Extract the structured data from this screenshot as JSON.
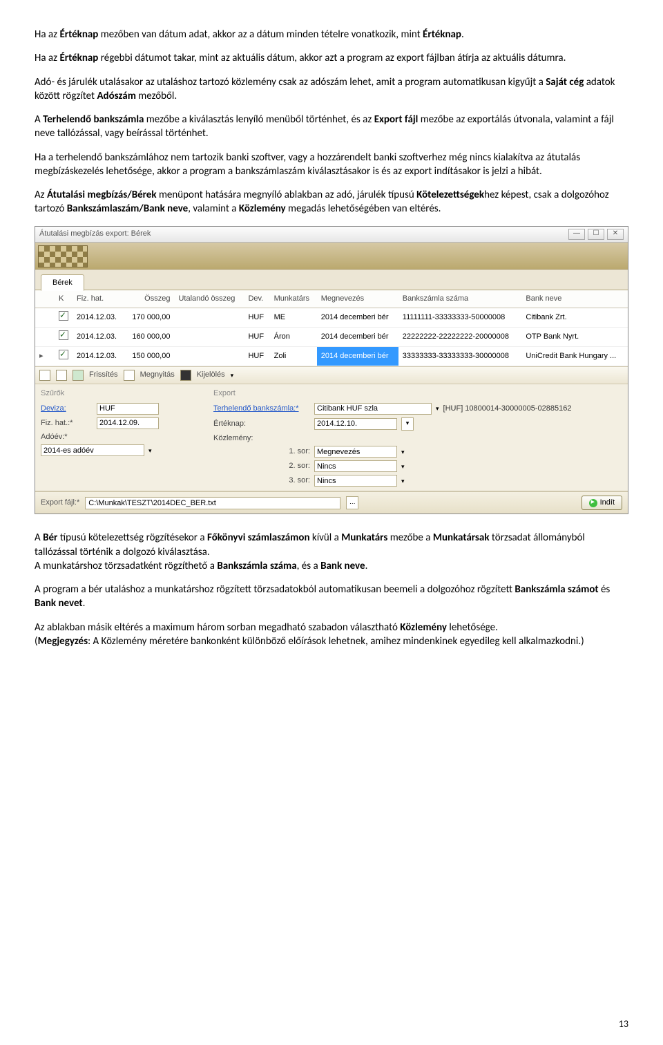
{
  "paragraphs": {
    "p1a": "Ha az ",
    "p1b": "Értéknap",
    "p1c": " mezőben van dátum adat, akkor az a dátum minden tételre vonatkozik, mint ",
    "p1d": "Értéknap",
    "p1e": ".",
    "p2a": "Ha az ",
    "p2b": "Értéknap",
    "p2c": " régebbi dátumot takar, mint az aktuális dátum, akkor azt a program az export fájlban átírja az aktuális dátumra.",
    "p3a": "Adó- és járulék utalásakor az utaláshoz tartozó közlemény csak az adószám lehet, amit a program automatikusan kigyűjt a ",
    "p3b": "Saját cég",
    "p3c": " adatok között rögzítet ",
    "p3d": "Adószám",
    "p3e": " mezőből.",
    "p4a": "A ",
    "p4b": "Terhelendő bankszámla",
    "p4c": " mezőbe a kiválasztás lenyíló menüből történhet, és az ",
    "p4d": "Export fájl",
    "p4e": " mezőbe az exportálás útvonala, valamint a fájl neve tallózással, vagy beírással történhet.",
    "p5": "Ha a terhelendő bankszámlához nem tartozik banki szoftver, vagy a hozzárendelt banki szoftverhez még nincs kialakítva az átutalás megbízáskezelés lehetősége, akkor a program a bankszámlaszám kiválasztásakor is és az export indításakor is jelzi a hibát.",
    "p6a": "Az ",
    "p6b": "Átutalási megbízás/Bérek",
    "p6c": " menüpont hatására megnyíló ablakban az adó, járulék típusú ",
    "p6d": "Kötelezettségek",
    "p6e": "hez képest, csak a dolgozóhoz tartozó ",
    "p6f": "Bankszámlaszám/Bank neve",
    "p6g": ", valamint a ",
    "p6h": "Közlemény",
    "p6i": " megadás lehetőségében van eltérés.",
    "p7a": "A ",
    "p7b": "Bér",
    "p7c": " típusú kötelezettség rögzítésekor a ",
    "p7d": "Főkönyvi számlaszámon",
    "p7e": " kívül a ",
    "p7f": "Munkatárs",
    "p7g": " mezőbe a ",
    "p7h": "Munkatársak",
    "p7i": " törzsadat állományból tallózással történik a dolgozó kiválasztása.",
    "p8a": "A munkatárshoz törzsadatként rögzíthető a ",
    "p8b": "Bankszámla száma",
    "p8c": ", és a ",
    "p8d": "Bank neve",
    "p8e": ".",
    "p9a": "A program a bér utaláshoz a munkatárshoz rögzített törzsadatokból automatikusan beemeli a dolgozóhoz rögzített ",
    "p9b": "Bankszámla számot",
    "p9c": " és ",
    "p9d": "Bank nevet",
    "p9e": ".",
    "p10a": "Az ablakban másik eltérés a maximum három sorban megadható szabadon választható ",
    "p10b": "Közlemény",
    "p10c": " lehetősége.",
    "p11a": "(",
    "p11b": "Megjegyzés",
    "p11c": ": A Közlemény méretére bankonként különböző előírások lehetnek, amihez mindenkinek egyedileg kell alkalmazkodni.)"
  },
  "window": {
    "title": "Átutalási megbízás export: Bérek",
    "tab": "Bérek",
    "headers": {
      "k": "K",
      "fizhat": "Fiz. hat.",
      "osszeg": "Összeg",
      "utalando": "Utalandó összeg",
      "dev": "Dev.",
      "munkatars": "Munkatárs",
      "megnevezes": "Megnevezés",
      "banksz": "Bankszámla száma",
      "bank": "Bank neve"
    },
    "rows": [
      {
        "fizhat": "2014.12.03.",
        "osszeg": "170 000,00",
        "utalando": "",
        "dev": "HUF",
        "munkatars": "ME",
        "megnevezes": "2014 decemberi bér",
        "banksz": "11111111-33333333-50000008",
        "bank": "Citibank Zrt."
      },
      {
        "fizhat": "2014.12.03.",
        "osszeg": "160 000,00",
        "utalando": "",
        "dev": "HUF",
        "munkatars": "Áron",
        "megnevezes": "2014 decemberi bér",
        "banksz": "22222222-22222222-20000008",
        "bank": "OTP Bank Nyrt."
      },
      {
        "fizhat": "2014.12.03.",
        "osszeg": "150 000,00",
        "utalando": "",
        "dev": "HUF",
        "munkatars": "Zoli",
        "megnevezes": "2014 decemberi bér",
        "banksz": "33333333-33333333-30000008",
        "bank": "UniCredit Bank Hungary ..."
      }
    ],
    "toolbar": {
      "frissites": "Frissítés",
      "megnyitas": "Megnyitás",
      "kijeloles": "Kijelölés"
    },
    "filters": {
      "szurok_h": "Szűrők",
      "export_h": "Export",
      "deviza_l": "Deviza:",
      "deviza_v": "HUF",
      "fizhat_l": "Fiz. hat.:*",
      "fizhat_v": "2014.12.09.",
      "adoev_l": "Adóév:*",
      "adoev_v": "2014-es adóév",
      "terh_l": "Terhelendő bankszámla:*",
      "terh_v": "Citibank HUF szla",
      "terh_info": "[HUF] 10800014-30000005-02885162",
      "erteknap_l": "Értéknap:",
      "erteknap_v": "2014.12.10.",
      "kozlemeny_l": "Közlemény:",
      "sor1_l": "1. sor:",
      "sor1_v": "Megnevezés",
      "sor2_l": "2. sor:",
      "sor2_v": "Nincs",
      "sor3_l": "3. sor:",
      "sor3_v": "Nincs"
    },
    "export": {
      "label": "Export fájl:*",
      "value": "C:\\Munkak\\TESZT\\2014DEC_BER.txt",
      "indit": "Indít"
    }
  },
  "page_number": "13"
}
